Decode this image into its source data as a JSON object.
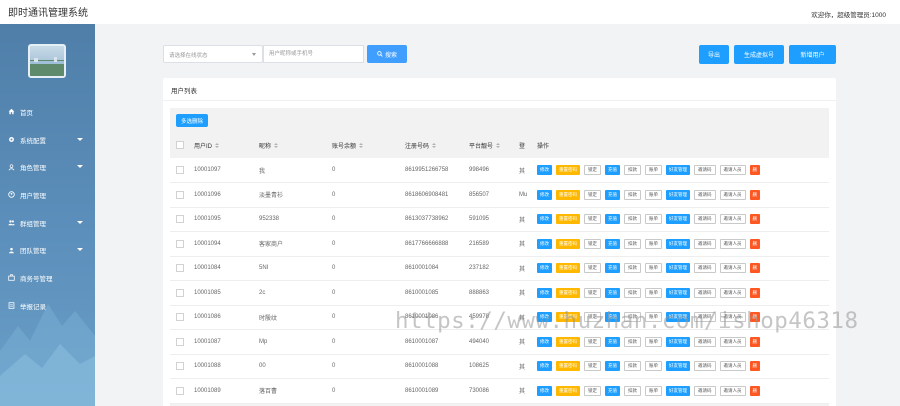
{
  "app": {
    "title": "即时通讯管理系统",
    "welcome": "欢迎你，超级管理员:1000"
  },
  "sidebar": {
    "items": [
      {
        "label": "首页",
        "icon": "home-icon",
        "has_caret": false
      },
      {
        "label": "系统配置",
        "icon": "gear-icon",
        "has_caret": true
      },
      {
        "label": "角色管理",
        "icon": "role-icon",
        "has_caret": true
      },
      {
        "label": "用户管理",
        "icon": "user-icon",
        "has_caret": false
      },
      {
        "label": "群组管理",
        "icon": "group-icon",
        "has_caret": true
      },
      {
        "label": "团队管理",
        "icon": "team-icon",
        "has_caret": true
      },
      {
        "label": "商务号管理",
        "icon": "business-icon",
        "has_caret": false
      },
      {
        "label": "举报记录",
        "icon": "report-icon",
        "has_caret": false
      }
    ]
  },
  "search": {
    "status_placeholder": "请选择在线状态",
    "keyword_placeholder": "用户昵称或手机号",
    "button": "搜索"
  },
  "toolbar": {
    "export": "导出",
    "generate_virtual": "生成虚拟号",
    "add_user": "新增用户"
  },
  "list": {
    "title": "用户列表",
    "batch_delete": "多选删除",
    "columns": [
      "用户ID",
      "昵称",
      "账号余额",
      "注册号码",
      "平台靓号",
      "登",
      "操作"
    ],
    "rows": [
      {
        "id": "10001097",
        "nick": "我",
        "balance": "0",
        "phone": "8619951266758",
        "acct": "998496",
        "extra": "其",
        "ops_first": "修改"
      },
      {
        "id": "10001096",
        "nick": "淡墨青衫",
        "balance": "0",
        "phone": "8618606908481",
        "acct": "856507",
        "extra": "Mu",
        "ops_first": "修改"
      },
      {
        "id": "10001095",
        "nick": "952338",
        "balance": "0",
        "phone": "8613037738962",
        "acct": "591095",
        "extra": "其",
        "ops_first": "修改"
      },
      {
        "id": "10001094",
        "nick": "客家商户",
        "balance": "0",
        "phone": "8617766666888",
        "acct": "216589",
        "extra": "其",
        "ops_first": "修改"
      },
      {
        "id": "10001084",
        "nick": "5NI",
        "balance": "0",
        "phone": "8610001084",
        "acct": "237182",
        "extra": "其",
        "ops_first": "修改"
      },
      {
        "id": "10001085",
        "nick": "2c",
        "balance": "0",
        "phone": "8610001085",
        "acct": "888863",
        "extra": "其",
        "ops_first": "修改"
      },
      {
        "id": "10001086",
        "nick": "时殷纹",
        "balance": "0",
        "phone": "8610001086",
        "acct": "459978",
        "extra": "其",
        "ops_first": "修改"
      },
      {
        "id": "10001087",
        "nick": "Mp",
        "balance": "0",
        "phone": "8610001087",
        "acct": "494040",
        "extra": "其",
        "ops_first": "修改"
      },
      {
        "id": "10001088",
        "nick": "00",
        "balance": "0",
        "phone": "8610001088",
        "acct": "108625",
        "extra": "其",
        "ops_first": "修改"
      },
      {
        "id": "10001089",
        "nick": "落百曹",
        "balance": "0",
        "phone": "8610001089",
        "acct": "730086",
        "extra": "其",
        "ops_first": "修改"
      }
    ],
    "operations": [
      {
        "label": "修改",
        "style": "blue"
      },
      {
        "label": "重置密码",
        "style": "orange"
      },
      {
        "label": "锁定",
        "style": "gray"
      },
      {
        "label": "充值",
        "style": "blue"
      },
      {
        "label": "扣款",
        "style": "gray"
      },
      {
        "label": "账单",
        "style": "gray"
      },
      {
        "label": "好友管理",
        "style": "blue"
      },
      {
        "label": "邀请码",
        "style": "gray"
      },
      {
        "label": "邀请人员",
        "style": "gray"
      },
      {
        "label": "删",
        "style": "red"
      }
    ]
  },
  "watermark": "https://www.huzhan.com/ishop46318",
  "colors": {
    "primary": "#1e9fff",
    "warning": "#ffb800",
    "danger": "#ff5722",
    "sidebar": "#5c8fbb"
  }
}
